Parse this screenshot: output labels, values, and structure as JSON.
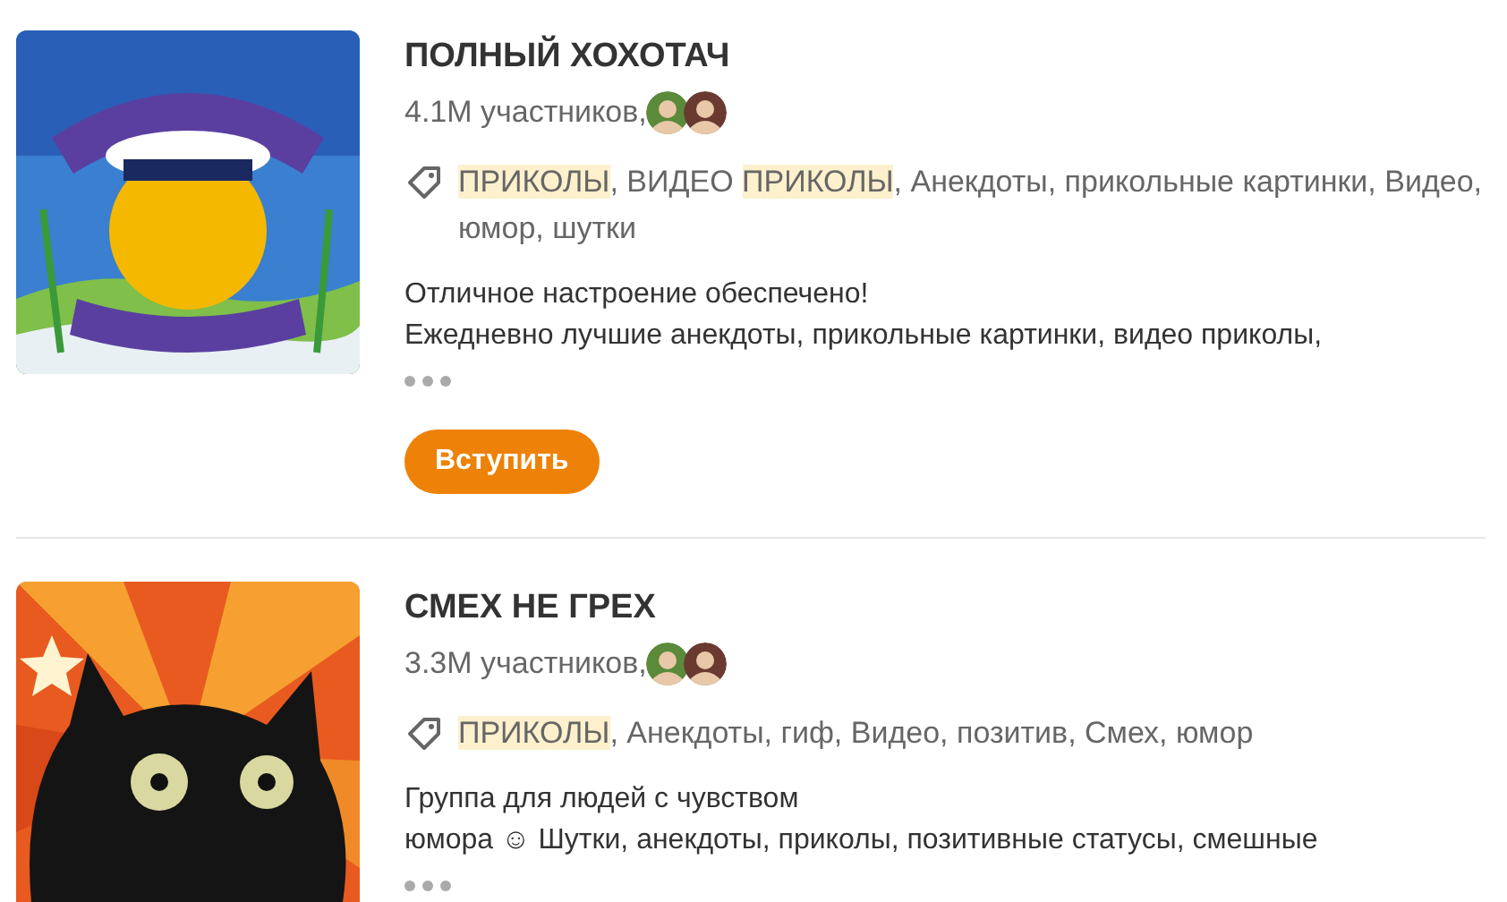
{
  "groups": [
    {
      "picture": {
        "kind": "picture"
      },
      "title": "ПОЛНЫЙ ХОХОТАЧ",
      "members": "4.1M участников,",
      "avatars": [
        {
          "kind": "picture"
        },
        {
          "kind": "picture"
        }
      ],
      "tags": [
        {
          "text": "ПРИКОЛЫ",
          "highlighted": true
        },
        {
          "text": ", ВИДЕО ",
          "highlighted": false
        },
        {
          "text": "ПРИКОЛЫ",
          "highlighted": true
        },
        {
          "text": ", Анекдоты, прикольные картинки, Видео, юмор, шутки",
          "highlighted": false
        }
      ],
      "description": [
        "Отличное настроение обеспечено!",
        "Ежедневно лучшие анекдоты, прикольные картинки, видео приколы,"
      ],
      "join_button": {
        "label": "Вступить"
      }
    },
    {
      "picture": {
        "kind": "picture"
      },
      "title": "СМЕХ НЕ ГРЕХ",
      "members": "3.3M участников,",
      "avatars": [
        {
          "kind": "picture"
        },
        {
          "kind": "picture"
        }
      ],
      "tags": [
        {
          "text": "ПРИКОЛЫ",
          "highlighted": true
        },
        {
          "text": ", Анекдоты, гиф, Видео, позитив, Смех, юмор",
          "highlighted": false
        }
      ],
      "description": [
        "Группа для людей с чувством",
        "юмора ☺ Шутки, анекдоты, приколы, позитивные статусы, смешные"
      ]
    }
  ]
}
